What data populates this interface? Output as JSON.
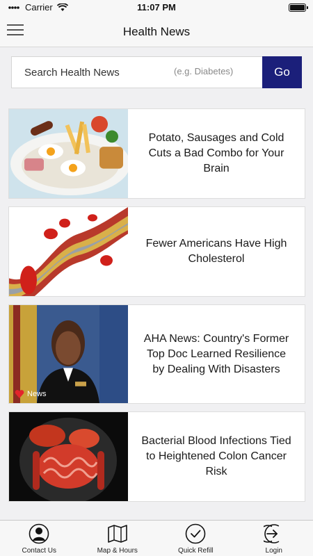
{
  "status_bar": {
    "carrier": "Carrier",
    "time": "11:07 PM"
  },
  "nav": {
    "title": "Health News"
  },
  "search": {
    "label": "Search Health News",
    "hint": "(e.g. Diabetes)",
    "button": "Go"
  },
  "articles": [
    {
      "headline": "Potato, Sausages and Cold Cuts a Bad Combo for Your Brain",
      "image": "breakfast-plate"
    },
    {
      "headline": "Fewer Americans Have High Cholesterol",
      "image": "artery-plaque"
    },
    {
      "headline": "AHA News: Country's Former Top Doc Learned Resilience by Dealing With Disasters",
      "image": "portrait-officer",
      "badge": "News"
    },
    {
      "headline": "Bacterial Blood Infections Tied to Heightened Colon Cancer Risk",
      "image": "digestive-system"
    }
  ],
  "tabs": [
    {
      "label": "Contact Us",
      "icon": "contact-icon"
    },
    {
      "label": "Map & Hours",
      "icon": "map-icon"
    },
    {
      "label": "Quick Refill",
      "icon": "refill-check-icon"
    },
    {
      "label": "Login",
      "icon": "login-icon"
    }
  ],
  "colors": {
    "accent": "#1b1f7a",
    "background": "#f0f0f2"
  }
}
